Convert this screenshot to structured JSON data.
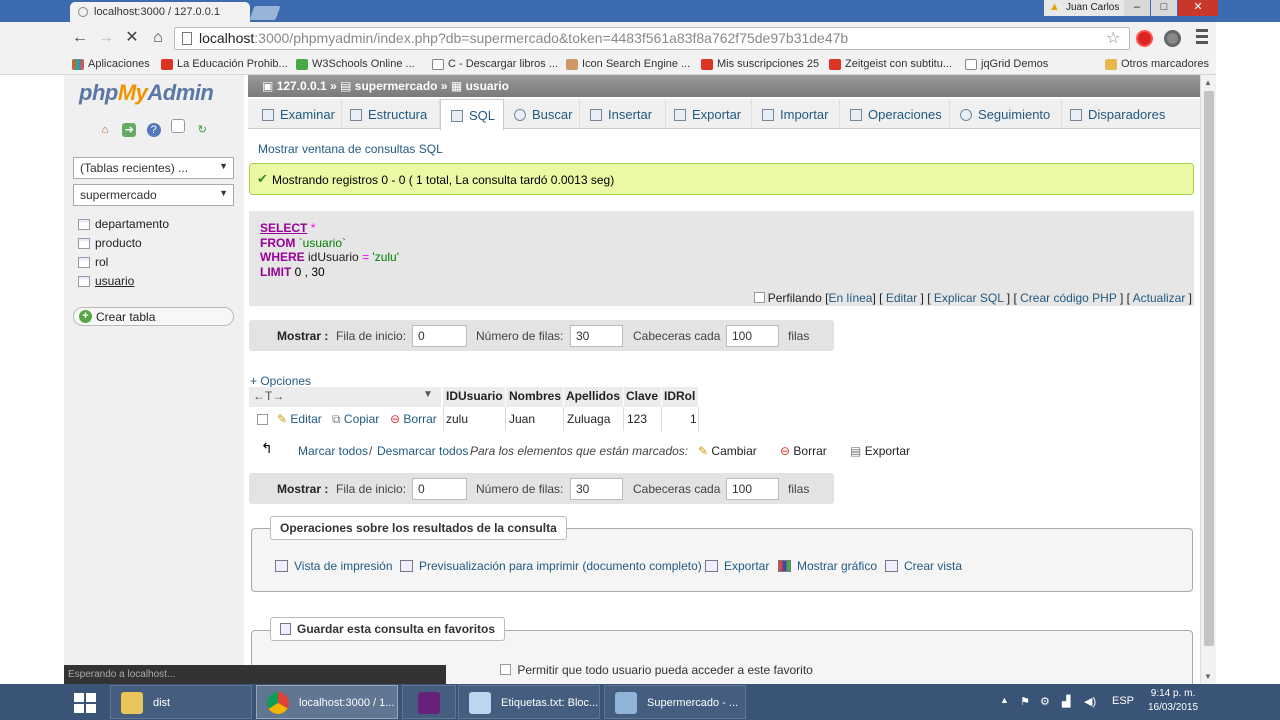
{
  "browser": {
    "tab_title": "localhost:3000 / 127.0.0.1",
    "user_name": "Juan Carlos",
    "window_minimize": "–",
    "window_maximize": "□",
    "window_close": "✕",
    "url_host": "localhost",
    "url_rest": ":3000/phpmyadmin/index.php?db=supermercado&token=4483f561a83f8a762f75de97b31de47b",
    "bookmarks": [
      "Aplicaciones",
      "La Educación Prohib...",
      "W3Schools Online ...",
      "C - Descargar libros ...",
      "Icon Search Engine ...",
      "Mis suscripciones 25",
      "Zeitgeist con subtitu...",
      "jqGrid Demos",
      "Otros marcadores"
    ]
  },
  "sidebar": {
    "logo_php": "php",
    "logo_my": "My",
    "logo_admin": "Admin",
    "recent_select": "(Tablas recientes) ...",
    "db_select": "supermercado",
    "tables": [
      "departamento",
      "producto",
      "rol",
      "usuario"
    ],
    "create_table": "Crear tabla"
  },
  "breadcrumb": {
    "server": "127.0.0.1",
    "sep": "»",
    "database": "supermercado",
    "table": "usuario"
  },
  "tabs": [
    "Examinar",
    "Estructura",
    "SQL",
    "Buscar",
    "Insertar",
    "Exportar",
    "Importar",
    "Operaciones",
    "Seguimiento",
    "Disparadores"
  ],
  "query": {
    "show_window": "Mostrar ventana de consultas SQL",
    "success_msg": "Mostrando registros 0 - 0 ( 1 total, La consulta tardó 0.0013 seg)",
    "sql": {
      "select": "SELECT",
      "star": "*",
      "from": "FROM",
      "table": "`usuario`",
      "where": "WHERE",
      "col": "idUsuario",
      "eq": "=",
      "val": "'zulu'",
      "limit": "LIMIT",
      "limit_vals": "0 , 30"
    },
    "profiling": "Perfilando",
    "links": [
      "En línea",
      "Editar",
      "Explicar SQL",
      "Crear código PHP",
      "Actualizar"
    ]
  },
  "navbar": {
    "show": "Mostrar :",
    "start_label": "Fila de inicio:",
    "start_value": "0",
    "rows_label": "Número de filas:",
    "rows_value": "30",
    "headers_label": "Cabeceras cada",
    "headers_value": "100",
    "rows_suffix": "filas"
  },
  "results": {
    "options": "+ Opciones",
    "arrows": "←T→",
    "columns": [
      "IDUsuario",
      "Nombres",
      "Apellidos",
      "Clave",
      "IDRol"
    ],
    "row_actions": [
      "Editar",
      "Copiar",
      "Borrar"
    ],
    "rows": [
      [
        "zulu",
        "Juan",
        "Zuluaga",
        "123",
        "1"
      ]
    ]
  },
  "bulk": {
    "select_all": "Marcar todos",
    "slash": "/",
    "deselect_all": "Desmarcar todos",
    "for_selected": "Para los elementos que están marcados:",
    "change": "Cambiar",
    "delete": "Borrar",
    "export": "Exportar"
  },
  "operations": {
    "legend": "Operaciones sobre los resultados de la consulta",
    "items": [
      "Vista de impresión",
      "Previsualización para imprimir (documento completo)",
      "Exportar",
      "Mostrar gráfico",
      "Crear vista"
    ]
  },
  "bookmark_section": {
    "legend": "Guardar esta consulta en favoritos",
    "permit": "Permitir que todo usuario pueda acceder a este favorito"
  },
  "status_tooltip": "Esperando a localhost...",
  "taskbar": {
    "items": [
      "dist",
      "localhost:3000 / 1...",
      "",
      "Etiquetas.txt: Bloc...",
      "Supermercado - ..."
    ],
    "lang": "ESP",
    "time": "9:14 p. m.",
    "date": "16/03/2015"
  },
  "colors": {
    "link": "#235a81",
    "success_bg": "#ebf8a4",
    "taskbar": "#3a5478"
  }
}
